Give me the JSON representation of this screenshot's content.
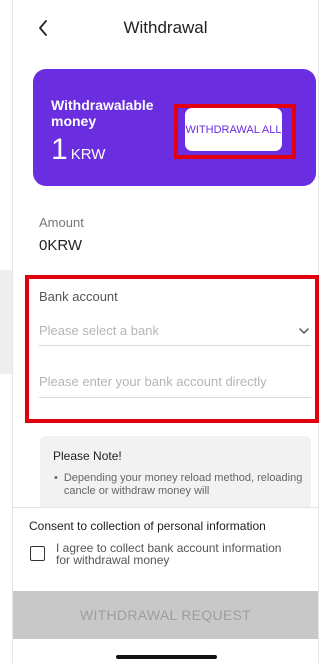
{
  "header": {
    "title": "Withdrawal",
    "back_icon": "chevron-left-icon"
  },
  "balance_card": {
    "label": "Withdrawalable money",
    "value": "1",
    "unit": "KRW",
    "withdraw_all_label": "WITHDRAWAL ALL",
    "bg_color": "#6a2de0"
  },
  "amount": {
    "label": "Amount",
    "value": "0KRW"
  },
  "bank": {
    "label": "Bank account",
    "select_placeholder": "Please select a bank",
    "select_icon": "chevron-down-icon",
    "account_placeholder": "Please enter your bank account directly"
  },
  "note": {
    "title": "Please Note!",
    "bullet": "•",
    "text": "Depending your money reload method, reloading cancle or withdraw money will"
  },
  "consent": {
    "title": "Consent to collection of personal information",
    "checkbox_label": "I agree to collect bank account information for withdrawal money",
    "checked": false
  },
  "submit": {
    "label": "WITHDRAWAL REQUEST"
  },
  "colors": {
    "accent": "#6a2de0",
    "highlight": "#e0000f",
    "disabled_button": "#c8c8c8"
  }
}
